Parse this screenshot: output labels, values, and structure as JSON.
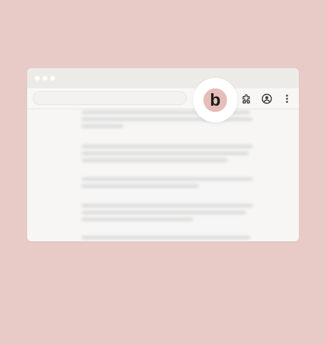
{
  "window": {
    "traffic_lights": [
      "close",
      "minimize",
      "maximize"
    ]
  },
  "toolbar": {
    "address_bar": {
      "value": "",
      "placeholder": ""
    },
    "icons": [
      "puzzle-icon",
      "profile-icon",
      "kebab-menu-icon"
    ]
  },
  "extension": {
    "icon": "b-logo-icon",
    "logo_letter": "b",
    "badge_color": "#e6bdb8",
    "logo_color": "#1b1b1b"
  },
  "content": {
    "blurred_paragraphs": 5
  },
  "colors": {
    "background": "#e8cac6",
    "window": "#f7f6f5",
    "titlebar": "#ecebe7"
  }
}
